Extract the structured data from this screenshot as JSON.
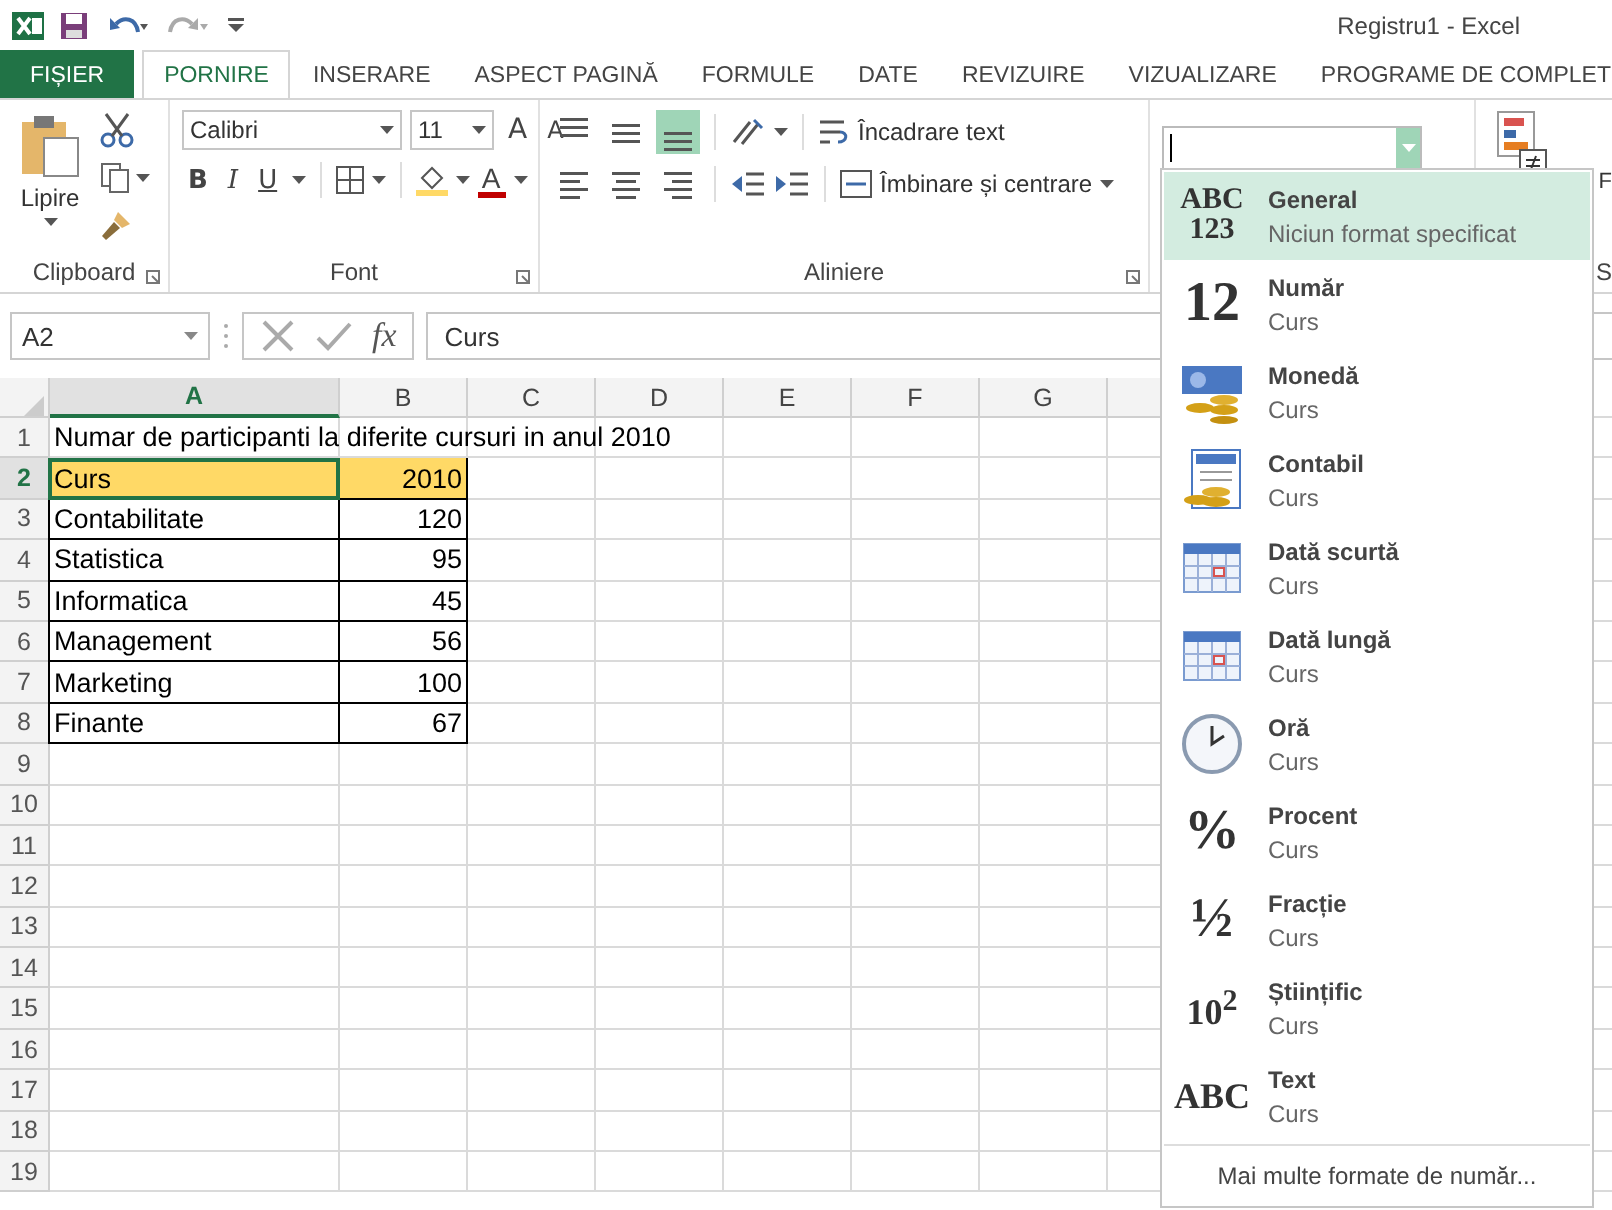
{
  "window": {
    "title": "Registru1 - Excel"
  },
  "tabs": [
    {
      "label": "FIȘIER",
      "kind": "file",
      "selected": false
    },
    {
      "label": "PORNIRE",
      "kind": "tab",
      "selected": true
    },
    {
      "label": "INSERARE",
      "kind": "tab",
      "selected": false
    },
    {
      "label": "ASPECT PAGINĂ",
      "kind": "tab",
      "selected": false
    },
    {
      "label": "FORMULE",
      "kind": "tab",
      "selected": false
    },
    {
      "label": "DATE",
      "kind": "tab",
      "selected": false
    },
    {
      "label": "REVIZUIRE",
      "kind": "tab",
      "selected": false
    },
    {
      "label": "VIZUALIZARE",
      "kind": "tab",
      "selected": false
    },
    {
      "label": "PROGRAME DE COMPLET",
      "kind": "tab",
      "selected": false
    }
  ],
  "ribbon": {
    "clipboard": {
      "paste_label": "Lipire",
      "group_label": "Clipboard"
    },
    "font": {
      "name": "Calibri",
      "size": "11",
      "grow_glyph": "A",
      "shrink_glyph": "A",
      "style_buttons": [
        "B",
        "I",
        "U"
      ],
      "color_glyph": "A",
      "group_label": "Font"
    },
    "alignment": {
      "vertical_buttons": [
        {
          "kind": "top",
          "selected": false
        },
        {
          "kind": "middle",
          "selected": false
        },
        {
          "kind": "bottom",
          "selected": true
        }
      ],
      "horizontal_buttons": [
        {
          "kind": "left",
          "selected": false
        },
        {
          "kind": "center",
          "selected": false
        },
        {
          "kind": "right",
          "selected": false
        }
      ],
      "wrap_label": "Încadrare text",
      "merge_label": "Îmbinare și centrare",
      "group_label": "Aliniere"
    },
    "styles": {
      "button_label": "F",
      "group_label": "S"
    }
  },
  "formula_bar": {
    "name_box": "A2",
    "function_label": "fx",
    "formula": "Curs"
  },
  "sheet": {
    "columns": [
      {
        "label": "A",
        "selected": true
      },
      {
        "label": "B",
        "selected": false
      },
      {
        "label": "C",
        "selected": false
      },
      {
        "label": "D",
        "selected": false
      },
      {
        "label": "E",
        "selected": false
      },
      {
        "label": "F",
        "selected": false
      },
      {
        "label": "G",
        "selected": false
      }
    ],
    "rows": [
      {
        "number": "1",
        "a": "Numar de participanti la diferite cursuri in anul 2010",
        "selected": false,
        "highlight": false,
        "bordered": false
      },
      {
        "number": "2",
        "a": "Curs",
        "b": "2010",
        "selected": true,
        "highlight": true,
        "bordered": true
      },
      {
        "number": "3",
        "a": "Contabilitate",
        "b": "120",
        "selected": false,
        "highlight": false,
        "bordered": true
      },
      {
        "number": "4",
        "a": "Statistica",
        "b": "95",
        "selected": false,
        "highlight": false,
        "bordered": true
      },
      {
        "number": "5",
        "a": "Informatica",
        "b": "45",
        "selected": false,
        "highlight": false,
        "bordered": true
      },
      {
        "number": "6",
        "a": "Management",
        "b": "56",
        "selected": false,
        "highlight": false,
        "bordered": true
      },
      {
        "number": "7",
        "a": "Marketing",
        "b": "100",
        "selected": false,
        "highlight": false,
        "bordered": true
      },
      {
        "number": "8",
        "a": "Finante",
        "b": "67",
        "selected": false,
        "highlight": false,
        "bordered": true
      },
      {
        "number": "9",
        "selected": false
      },
      {
        "number": "10",
        "selected": false
      },
      {
        "number": "11",
        "selected": false
      },
      {
        "number": "12",
        "selected": false
      },
      {
        "number": "13",
        "selected": false
      },
      {
        "number": "14",
        "selected": false
      },
      {
        "number": "15",
        "selected": false
      },
      {
        "number": "16",
        "selected": false
      },
      {
        "number": "17",
        "selected": false
      },
      {
        "number": "18",
        "selected": false
      },
      {
        "number": "19",
        "selected": false
      }
    ]
  },
  "format_menu": {
    "open": true,
    "items": [
      {
        "kind": "glyph",
        "glyph_lines": [
          "ABC",
          "123"
        ],
        "name": "General",
        "sample": "Niciun format specificat",
        "selected": true
      },
      {
        "kind": "glyph",
        "glyph_lines": [
          "12"
        ],
        "name": "Număr",
        "sample": "Curs",
        "selected": false
      },
      {
        "kind": "currency",
        "name": "Monedă",
        "sample": "Curs",
        "selected": false
      },
      {
        "kind": "accounting",
        "name": "Contabil",
        "sample": "Curs",
        "selected": false
      },
      {
        "kind": "calendar",
        "name": "Dată scurtă",
        "sample": "Curs",
        "selected": false
      },
      {
        "kind": "calendar",
        "name": "Dată lungă",
        "sample": "Curs",
        "selected": false
      },
      {
        "kind": "clock",
        "name": "Oră",
        "sample": "Curs",
        "selected": false
      },
      {
        "kind": "glyph",
        "glyph_lines": [
          "%"
        ],
        "name": "Procent",
        "sample": "Curs",
        "selected": false
      },
      {
        "kind": "glyph",
        "glyph_lines": [
          "½"
        ],
        "name": "Fracție",
        "sample": "Curs",
        "selected": false
      },
      {
        "kind": "glyph",
        "glyph_lines": [
          "10$^{2}$"
        ],
        "name": "Științific",
        "sample": "Curs",
        "selected": false
      },
      {
        "kind": "glyph",
        "glyph_lines": [
          "ABC"
        ],
        "name": "Text",
        "sample": "Curs",
        "selected": false
      }
    ],
    "footer": "Mai multe formate de număr..."
  }
}
